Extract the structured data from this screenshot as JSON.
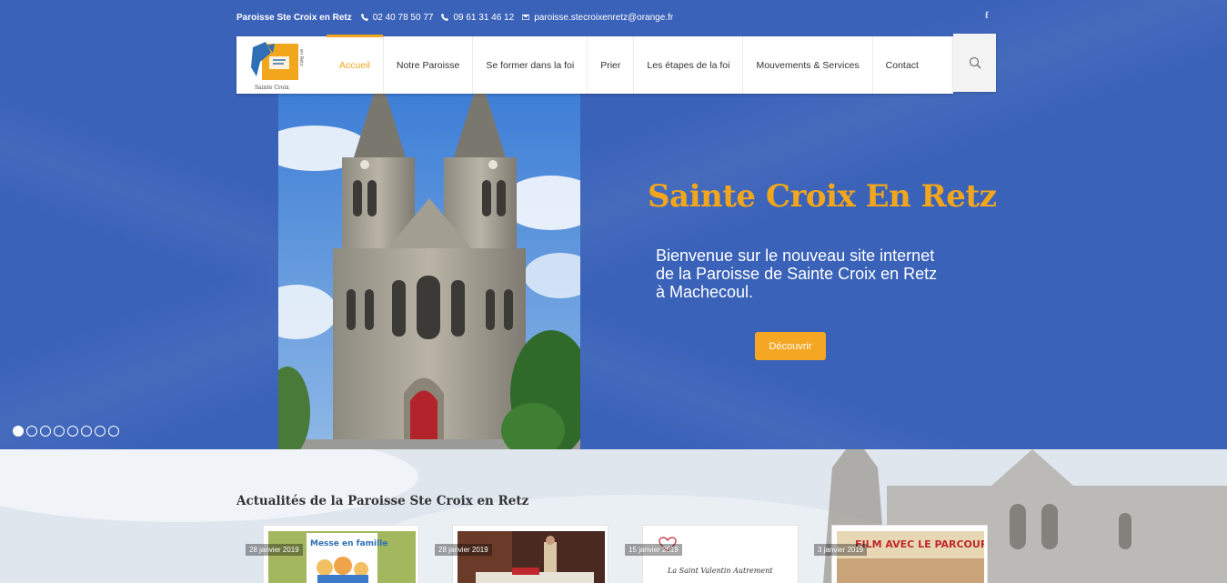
{
  "topbar": {
    "site_name": "Paroisse Ste Croix en Retz",
    "phone1": "02 40 78 50 77",
    "phone2": "09 61 31 46 12",
    "email": "paroisse.stecroixenretz@orange.fr"
  },
  "social": {
    "facebook": "f"
  },
  "nav": {
    "logo_text": "Sainte Croix",
    "items": [
      {
        "label": "Accueil"
      },
      {
        "label": "Notre Paroisse"
      },
      {
        "label": "Se former dans la foi"
      },
      {
        "label": "Prier"
      },
      {
        "label": "Les étapes de la foi"
      },
      {
        "label": "Mouvements & Services"
      },
      {
        "label": "Contact"
      }
    ]
  },
  "hero": {
    "title": "Sainte Croix En Retz",
    "text": "Bienvenue sur le nouveau site internet de la Paroisse de Sainte Croix en Retz à Machecoul.",
    "cta": "Découvrir"
  },
  "news": {
    "title": "Actualités de la Paroisse Ste Croix en Retz",
    "cards": [
      {
        "date": "28 janvier 2019",
        "image_text": "Messe en famille"
      },
      {
        "date": "28 janvier 2019",
        "image_text": ""
      },
      {
        "date": "15 janvier 2019",
        "image_text": "La Saint Valentin Autrement"
      },
      {
        "date": "3 janvier 2019",
        "image_text": "FILM AVEC LE PARCOURS ALP"
      }
    ]
  },
  "colors": {
    "hero_blue": "#3a62b9",
    "accent_orange": "#f2a61c",
    "button_orange": "#f5a623"
  },
  "slider": {
    "count": 8,
    "active": 1
  }
}
